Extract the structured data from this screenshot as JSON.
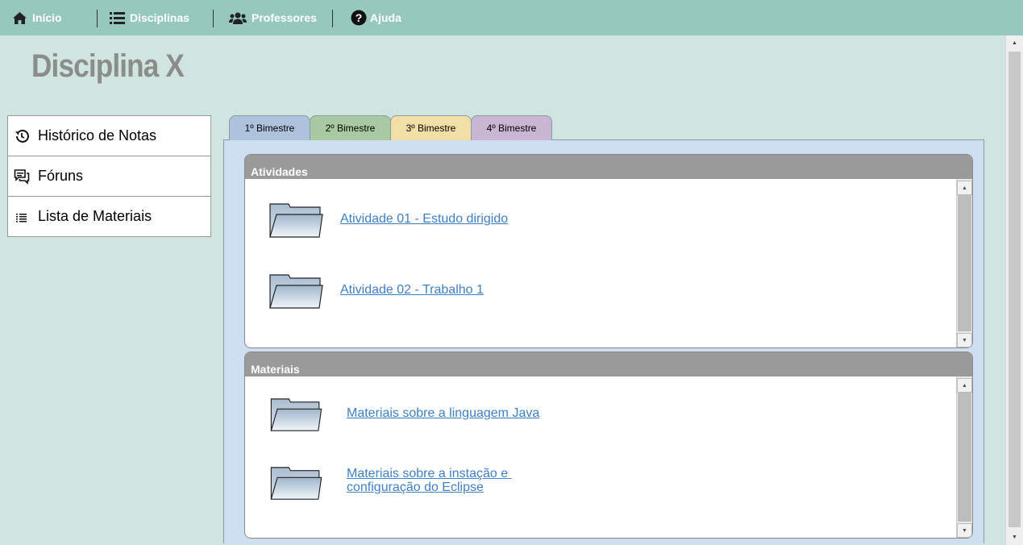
{
  "nav": {
    "items": [
      {
        "label": "Início",
        "icon": "home-icon"
      },
      {
        "label": "Disciplinas",
        "icon": "list-icon"
      },
      {
        "label": "Professores",
        "icon": "users-icon"
      },
      {
        "label": "Ajuda",
        "icon": "help-icon"
      }
    ]
  },
  "page": {
    "title": "Disciplina X"
  },
  "sidebar": {
    "items": [
      {
        "label": "Histórico de Notas",
        "icon": "history-icon"
      },
      {
        "label": "Fóruns",
        "icon": "chat-icon"
      },
      {
        "label": "Lista de Materiais",
        "icon": "list-icon"
      }
    ]
  },
  "tabs": [
    {
      "label": "1º Bimestre",
      "color": "#aec2dc"
    },
    {
      "label": "2º Bimestre",
      "color": "#a9c9a2"
    },
    {
      "label": "3º Bimestre",
      "color": "#f2dfa6"
    },
    {
      "label": "4º Bimestre",
      "color": "#c8b6d2"
    }
  ],
  "sections": {
    "atividades": {
      "title": "Atividades",
      "items": [
        {
          "label": "Atividade 01 - Estudo dirigido"
        },
        {
          "label": "Atividade 02 - Trabalho 1"
        }
      ]
    },
    "materiais": {
      "title": "Materiais",
      "items": [
        {
          "label": "Materiais sobre a linguagem Java"
        },
        {
          "label_line1": "Materiais sobre a instação e ",
          "label_line2": "configuração do Eclipse"
        }
      ]
    }
  },
  "colors": {
    "nav_bg": "#97c8bd",
    "page_bg": "#cfe5e0",
    "panel_bg": "#cfdff2",
    "link": "#3f7fc4",
    "section_header": "#9a9a9a"
  }
}
